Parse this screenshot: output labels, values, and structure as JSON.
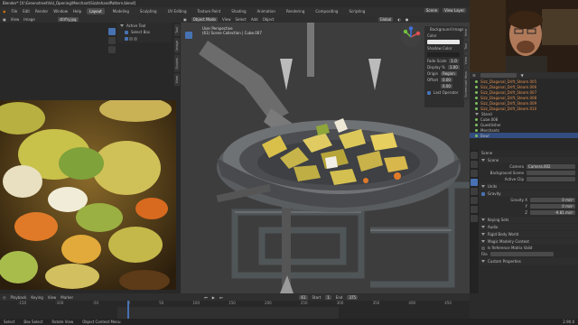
{
  "window": {
    "title": "Blender* [X:\\Greenstreet\\Vol_Opening\\Merchant\\SizzlehandPattern.blend]"
  },
  "menu": {
    "items": [
      "File",
      "Edit",
      "Render",
      "Window",
      "Help"
    ],
    "workspaces": [
      "Layout",
      "Modeling",
      "Sculpting",
      "UV Editing",
      "Texture Paint",
      "Shading",
      "Animation",
      "Rendering",
      "Compositing",
      "Scripting"
    ],
    "active_workspace": "Layout",
    "scene_label": "Scene",
    "view_layer_label": "View Layer"
  },
  "image_editor": {
    "header": {
      "view": "View",
      "image": "Image",
      "filename": "stirfry.jpg"
    },
    "tool_panel_title": "Active Tool",
    "tool_item": "Select Box",
    "tabs": [
      "Tool",
      "Image",
      "Scopes",
      "View"
    ]
  },
  "viewport": {
    "header": {
      "mode": "Object Mode",
      "view": "View",
      "select": "Select",
      "add": "Add",
      "object": "Object",
      "orientation": "Global"
    },
    "overlay_title": "User Perspective",
    "overlay_subtitle": "(61) Scene Collection | Cube.007",
    "bg_image_panel": {
      "title": "Background Image",
      "color_label": "Color",
      "shadow_color_label": "Shadow Color",
      "fade_label": "Fade Scale",
      "fade_value": "1.0",
      "display_label": "Display %",
      "display_value": "1.00",
      "origin_label": "Origin",
      "origin_value": "Region",
      "offset_label": "Offset",
      "offset_x": "0.00",
      "offset_y": "0.00",
      "last_operator": "Last Operator",
      "tabs": [
        "Item",
        "Tool",
        "View",
        "Screencast Keys"
      ]
    }
  },
  "outliner": {
    "items": [
      {
        "name": "Sizz_Diagonal_Drift_Steam.005",
        "selected": false
      },
      {
        "name": "Sizz_Diagonal_Drift_Steam.006",
        "selected": false
      },
      {
        "name": "Sizz_Diagonal_Drift_Steam.007",
        "selected": false
      },
      {
        "name": "Sizz_Diagonal_Drift_Steam.008",
        "selected": false
      },
      {
        "name": "Sizz_Diagonal_Drift_Steam.009",
        "selected": false
      },
      {
        "name": "Sizz_Diagonal_Drift_Steam.010",
        "selected": false
      },
      {
        "name": "Stand",
        "selected": false
      },
      {
        "name": "Cube.008",
        "selected": false
      },
      {
        "name": "Guestlisher",
        "selected": false
      },
      {
        "name": "Merchants",
        "selected": false
      },
      {
        "name": "Bowl",
        "selected": true
      }
    ]
  },
  "properties": {
    "scene_name": "Scene",
    "camera_label": "Camera",
    "camera_value": "Camera.002",
    "background_scene_label": "Background Scene",
    "active_clip_label": "Active Clip",
    "units_label": "Units",
    "gravity_label": "Gravity",
    "gravity_x_label": "Gravity X",
    "gravity_x_value": "0 m/s²",
    "gravity_y_label": "Y",
    "gravity_y_value": "0 m/s²",
    "gravity_z_label": "Z",
    "gravity_z_value": "-9.81 m/s²",
    "sections": [
      "Keying Sets",
      "Audio",
      "Rigid Body World",
      "Simplify",
      "Custom Properties"
    ],
    "mmc_label": "Magic Modelry Context",
    "ref_label": "Is Reference Matrix Valid",
    "file_label": "File"
  },
  "timeline": {
    "menu": [
      "Playback",
      "Keying",
      "View",
      "Marker"
    ],
    "current_frame": "61",
    "start_label": "Start",
    "start_value": "1",
    "end_label": "End",
    "end_value": "375",
    "ticks": [
      "-150",
      "-100",
      "-50",
      "0",
      "50",
      "100",
      "150",
      "200",
      "250",
      "300",
      "350",
      "400",
      "450"
    ]
  },
  "statusbar": {
    "select": "Select",
    "box_select": "Box Select",
    "rotate_view": "Rotate View",
    "context_menu": "Object Context Menu",
    "version": "2.90.0"
  }
}
